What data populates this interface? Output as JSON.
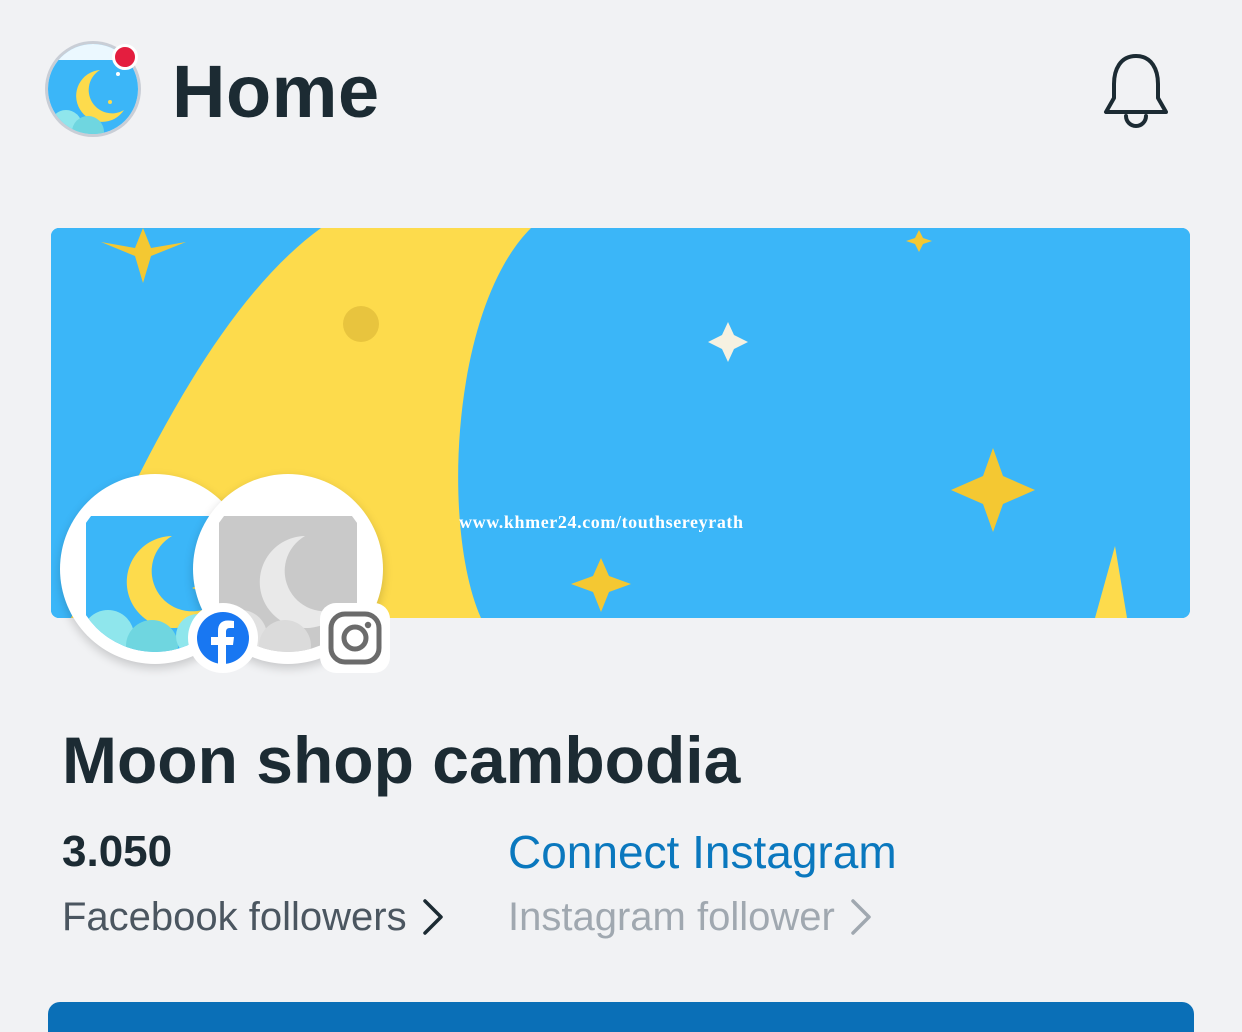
{
  "header": {
    "title": "Home",
    "avatar_icon": "moon-logo-icon",
    "notification_icon": "bell-icon",
    "notification_dot_color": "#e41e3f"
  },
  "cover": {
    "url_text": "www.khmer24.com/touthsereyrath",
    "background_color": "#3bb6f8",
    "moon_color": "#fddb4c"
  },
  "profiles": {
    "facebook_icon": "facebook-icon",
    "instagram_icon": "instagram-icon"
  },
  "page": {
    "name": "Moon shop cambodia"
  },
  "stats": {
    "facebook_followers_value": "3.050",
    "facebook_followers_label": "Facebook followers",
    "connect_instagram_label": "Connect Instagram",
    "instagram_follower_label": "Instagram follower"
  },
  "colors": {
    "link": "#0a78be",
    "primary_bar": "#0a6fb7"
  }
}
